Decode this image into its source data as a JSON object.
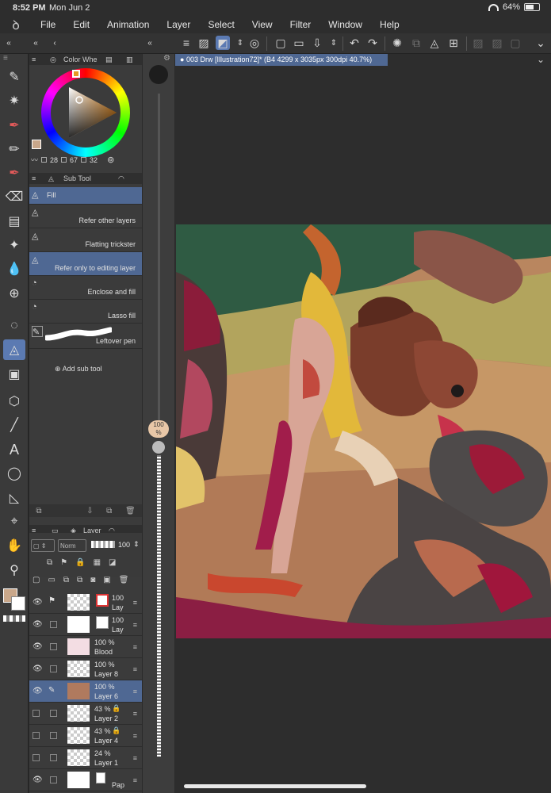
{
  "status": {
    "time": "8:52 PM",
    "date": "Mon Jun 2",
    "battery": "64%",
    "battery_level": 0.64
  },
  "menu": [
    "File",
    "Edit",
    "Animation",
    "Layer",
    "Select",
    "View",
    "Filter",
    "Window",
    "Help"
  ],
  "color_panel": {
    "tab_label": "Color Whe",
    "main_color": "#c9a78a",
    "sub_color": "#ffffff",
    "h": "28",
    "s": "67",
    "v": "32"
  },
  "subtool_panel": {
    "tab_label": "Sub Tool",
    "items": [
      {
        "label": "Fill",
        "selected": true
      },
      {
        "label": "Refer other layers",
        "selected": false
      },
      {
        "label": "Flatting trickster",
        "selected": false
      },
      {
        "label": "Refer only to editing layer",
        "selected": true
      },
      {
        "label": "Enclose and fill",
        "selected": false
      },
      {
        "label": "Lasso fill",
        "selected": false
      },
      {
        "label": "Leftover pen",
        "selected": false
      }
    ],
    "add_label": "Add sub tool"
  },
  "layer_panel": {
    "tab_label": "Layer",
    "blend_mode": "Norm",
    "opacity": "100",
    "layers": [
      {
        "opacity": "100",
        "name": "Lay",
        "selected": false
      },
      {
        "opacity": "100",
        "name": "Lay",
        "selected": false
      },
      {
        "opacity": "100 %",
        "name": "Blood",
        "selected": false
      },
      {
        "opacity": "100 %",
        "name": "Layer 8",
        "selected": false
      },
      {
        "opacity": "100 %",
        "name": "Layer 6",
        "selected": true
      },
      {
        "opacity": "43 %",
        "name": "Layer 2",
        "selected": false
      },
      {
        "opacity": "43 %",
        "name": "Layer 4",
        "selected": false
      },
      {
        "opacity": "24 %",
        "name": "Layer 1",
        "selected": false
      },
      {
        "opacity": "",
        "name": "Pap",
        "selected": false
      }
    ]
  },
  "brush_size": {
    "value": "100",
    "unit": "%"
  },
  "document": {
    "tab_title": "003 Drw [Illustration72]* (B4 4299 x 3035px 300dpi 40.7%)"
  },
  "accent_color": "#5b7ab2"
}
